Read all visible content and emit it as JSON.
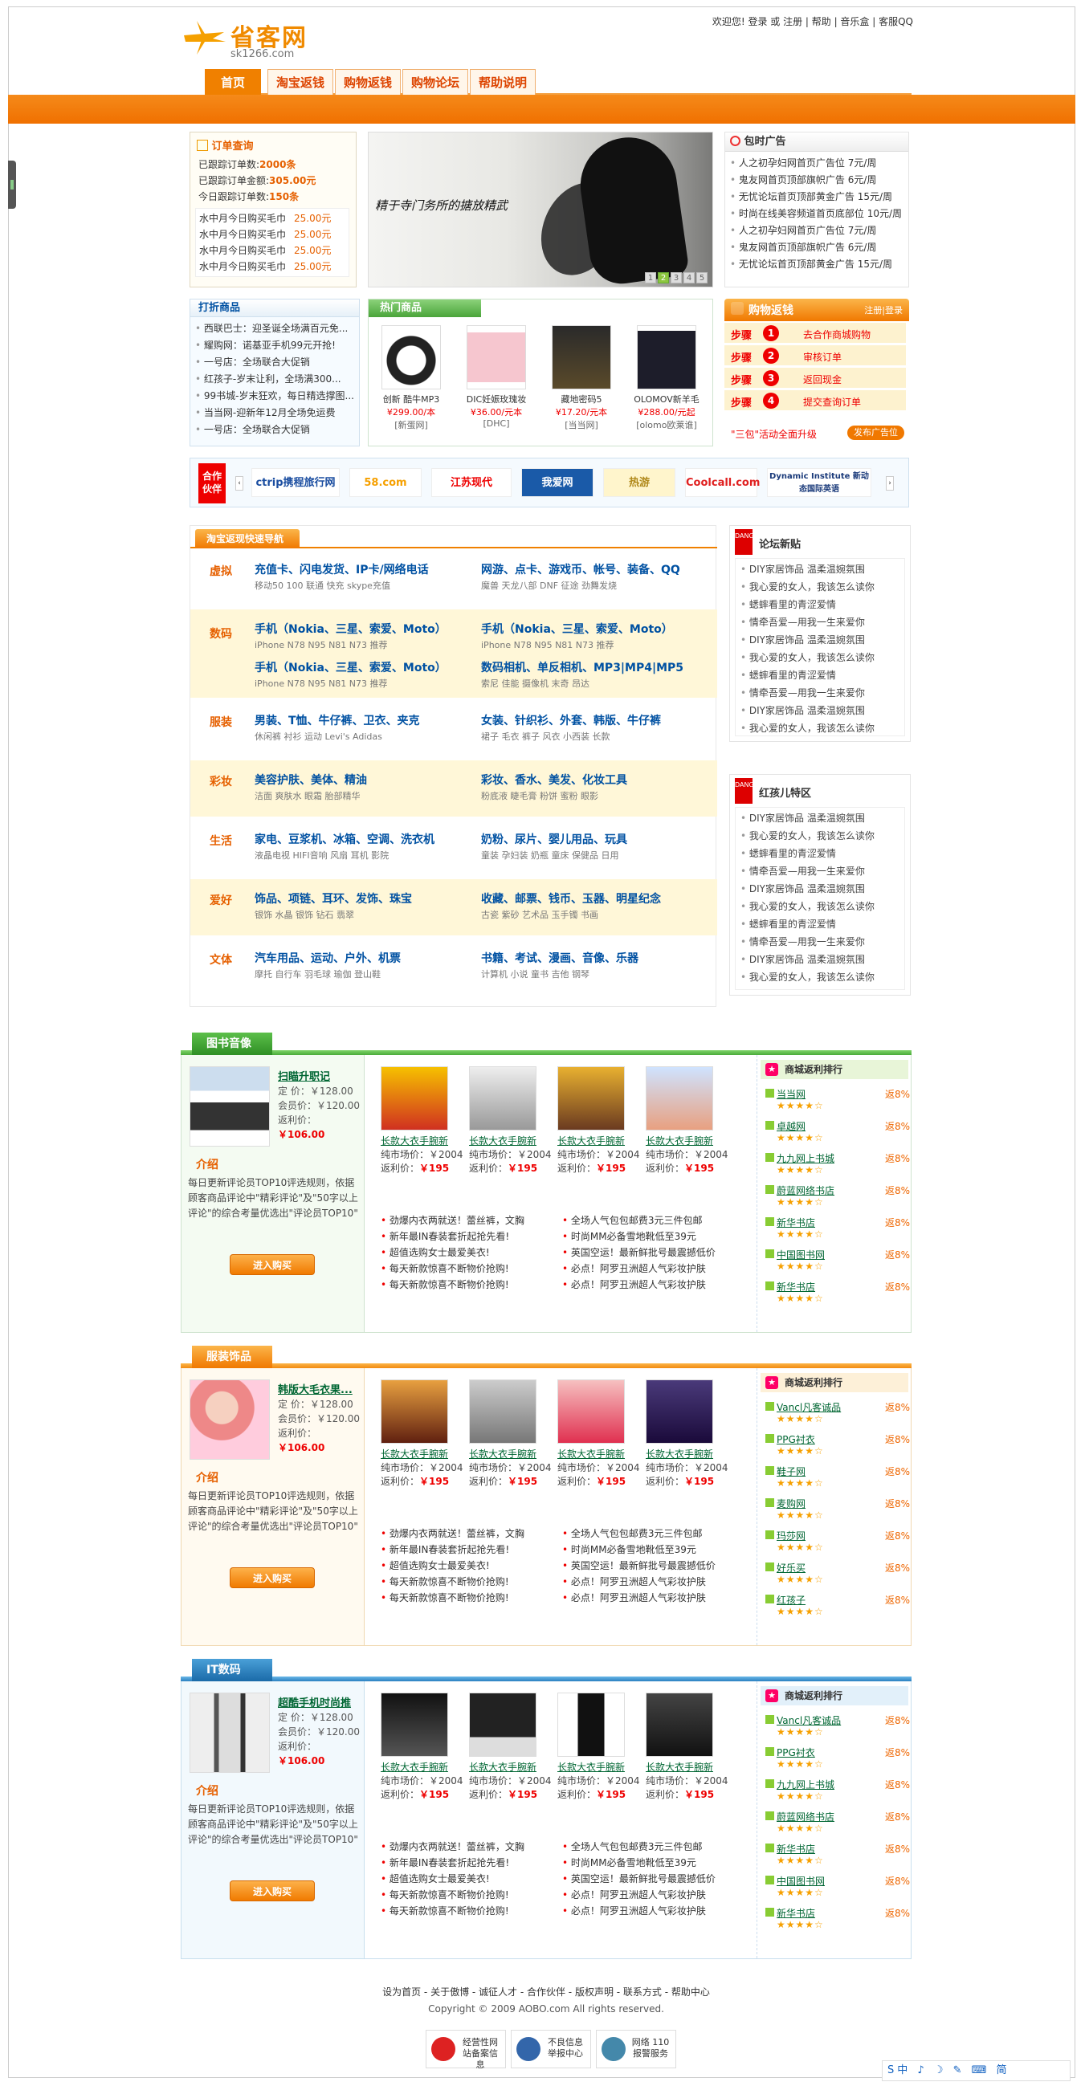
{
  "header": {
    "logo_text": "省客网",
    "logo_sub": "sk1266.com",
    "top_links": "欢迎您! 登录 或 注册 | 帮助 | 音乐盒 | 客服QQ"
  },
  "nav": [
    "首页",
    "淘宝返钱",
    "购物返钱",
    "购物论坛",
    "帮助说明"
  ],
  "orders": {
    "title": "订单查询",
    "stats": [
      {
        "label": "已跟踪订单数:",
        "value": "2000条"
      },
      {
        "label": "已跟踪订单金额:",
        "value": "305.00元"
      },
      {
        "label": "今日跟踪订单数:",
        "value": "150条"
      }
    ],
    "items": [
      {
        "name": "水中月今日购买毛巾",
        "price": "25.00元"
      },
      {
        "name": "水中月今日购买毛巾",
        "price": "25.00元"
      },
      {
        "name": "水中月今日购买毛巾",
        "price": "25.00元"
      },
      {
        "name": "水中月今日购买毛巾",
        "price": "25.00元"
      }
    ]
  },
  "banner": {
    "slogan": "精于寺门务所的搪放精武",
    "pages": [
      "1",
      "2",
      "3",
      "4",
      "5"
    ],
    "active_page": "2"
  },
  "ads": {
    "title": "包时广告",
    "items": [
      "人之初孕妇网首页广告位 7元/周",
      "鬼友网首页顶部旗帜广告 6元/周",
      "无忧论坛首页顶部黄金广告 15元/周",
      "时尚在线美容频道首页底部位 10元/周",
      "人之初孕妇网首页广告位 7元/周",
      "鬼友网首页顶部旗帜广告 6元/周",
      "无忧论坛首页顶部黄金广告 15元/周"
    ]
  },
  "deals": {
    "title": "打折商品",
    "items": [
      "西联巴士：迎圣诞全场满百元免...",
      "耀购网：诺基亚手机99元开抢!",
      "一号店：全场联合大促销",
      "红孩子-岁末让利，全场满300...",
      "99书城-岁末狂欢，每日精选撑图...",
      "当当网-迎新年12月全场免运费",
      "一号店：全场联合大促销"
    ]
  },
  "hot": {
    "title": "热门商品",
    "items": [
      {
        "name": "创新 酷牛MP3",
        "price": "¥299.00/本",
        "shop": "[新蛋网]"
      },
      {
        "name": "DIC妊娠玫瑰妆",
        "price": "¥36.00/元本",
        "shop": "[DHC]"
      },
      {
        "name": "藏地密码5",
        "price": "¥17.20/元本",
        "shop": "[当当网]"
      },
      {
        "name": "OLOMOV新羊毛",
        "price": "¥288.00/元起",
        "shop": "[olomo欧莱谁]"
      }
    ]
  },
  "shop_steps": {
    "title": "购物返钱",
    "login": "注册|登录",
    "steps": [
      {
        "label": "步骤",
        "num": "1",
        "text": "去合作商城购物"
      },
      {
        "label": "步骤",
        "num": "2",
        "text": "审核订单"
      },
      {
        "label": "步骤",
        "num": "3",
        "text": "返回现金"
      },
      {
        "label": "步骤",
        "num": "4",
        "text": "提交查询订单"
      }
    ],
    "footer_left": "\"三包\"活动全面升级",
    "footer_right": "发布广告位"
  },
  "partners": {
    "title": "合作伙伴",
    "items": [
      "ctrip携程旅行网",
      "58.com",
      "江苏现代",
      "我爱网",
      "热游",
      "Coolcall.com",
      "Dynamic Institute 新动态国际英语"
    ]
  },
  "guide": {
    "title": "淘宝返现快速导航",
    "rows": [
      {
        "cat": "虚拟",
        "a_main": "充值卡、闪电发货、IP卡/网络电话",
        "a_sub": "移动50  100  联通  快充  skype充值",
        "b_main": "网游、点卡、游戏币、帐号、装备、QQ",
        "b_sub": "魔兽  天龙八部  DNF  征途  劲舞发烧",
        "c_main": "",
        "c_sub": "",
        "d_main": "",
        "d_sub": ""
      },
      {
        "cat": "数码",
        "a_main": "手机（Nokia、三星、索爱、Moto）",
        "a_sub": "iPhone  N78  N95  N81  N73  推荐",
        "b_main": "手机（Nokia、三星、索爱、Moto）",
        "b_sub": "iPhone  N78  N95  N81  N73  推荐",
        "c_main": "手机（Nokia、三星、索爱、Moto）",
        "c_sub": "iPhone  N78  N95  N81  N73  推荐",
        "d_main": "数码相机、单反相机、MP3|MP4|MP5",
        "d_sub": "索尼  佳能  摄像机  末奇  昂达"
      },
      {
        "cat": "服装",
        "a_main": "男装、T恤、牛仔裤、卫衣、夹克",
        "a_sub": "休闲裤  衬衫  运动  Levi's  Adidas",
        "b_main": "女装、针织衫、外套、韩版、牛仔裤",
        "b_sub": "裙子  毛衣  裤子  风衣  小西装  长款",
        "c_main": "",
        "c_sub": "",
        "d_main": "",
        "d_sub": ""
      },
      {
        "cat": "彩妆",
        "a_main": "美容护肤、美体、精油",
        "a_sub": "洁面  爽肤水  眼霜  胎部精华",
        "b_main": "彩妆、香水、美发、化妆工具",
        "b_sub": "粉底液  睫毛膏  粉饼  蜜粉  眼影",
        "c_main": "",
        "c_sub": "",
        "d_main": "",
        "d_sub": ""
      },
      {
        "cat": "生活",
        "a_main": "家电、豆浆机、冰箱、空调、洗衣机",
        "a_sub": "液晶电视  HIFI音响  风扇  耳机  影院",
        "b_main": "奶粉、尿片、婴儿用品、玩具",
        "b_sub": "童装  孕妇装  奶瓶  童床  保健品  日用",
        "c_main": "",
        "c_sub": "",
        "d_main": "",
        "d_sub": ""
      },
      {
        "cat": "爱好",
        "a_main": "饰品、项链、耳环、发饰、珠宝",
        "a_sub": "银饰  水晶  银饰  钻石  翡翠",
        "b_main": "收藏、邮票、钱币、玉器、明星纪念",
        "b_sub": "古瓷  紫砂  艺术品  玉手镯  书画",
        "c_main": "",
        "c_sub": "",
        "d_main": "",
        "d_sub": ""
      },
      {
        "cat": "文体",
        "a_main": "汽车用品、运动、户外、机票",
        "a_sub": "摩托  自行车  羽毛球  瑜伽  登山鞋",
        "b_main": "书籍、考试、漫画、音像、乐器",
        "b_sub": "计算机  小说  童书  吉他  钢琴",
        "c_main": "",
        "c_sub": "",
        "d_main": "",
        "d_sub": ""
      }
    ]
  },
  "forum": {
    "title": "论坛新贴",
    "badge": "DANG",
    "items": [
      "DIY家居饰品 温柔温婉氛围",
      "我心爱的女人，我该怎么读你",
      "蟋蟀看里的青涩爱情",
      "情牵吾爱—用我一生来爱你",
      "DIY家居饰品 温柔温婉氛围",
      "我心爱的女人，我该怎么读你",
      "蟋蟀看里的青涩爱情",
      "情牵吾爱—用我一生来爱你",
      "DIY家居饰品 温柔温婉氛围",
      "我心爱的女人，我该怎么读你"
    ]
  },
  "kids": {
    "title": "红孩儿特区",
    "badge": "DANG",
    "items": [
      "DIY家居饰品 温柔温婉氛围",
      "我心爱的女人，我该怎么读你",
      "蟋蟀看里的青涩爱情",
      "情牵吾爱—用我一生来爱你",
      "DIY家居饰品 温柔温婉氛围",
      "我心爱的女人，我该怎么读你",
      "蟋蟀看里的青涩爱情",
      "情牵吾爱—用我一生来爱你",
      "DIY家居饰品 温柔温婉氛围",
      "我心爱的女人，我该怎么读你"
    ]
  },
  "sections": [
    {
      "title": "图书音像",
      "feature": {
        "name": "扫瞄升职记",
        "list": "定  价：￥128.00",
        "member": "会员价：￥120.00",
        "rebate": "返利价：",
        "rebate_val": "￥106.00"
      },
      "intro_title": "介绍",
      "intro": "每日更新评论员TOP10评选规则，依据顾客商品评论中\"精彩评论\"及\"50字以上评论\"的综合考量优选出\"评论员TOP10\"",
      "buy": "进入购买",
      "products": [
        {
          "name": "长款大衣手腕新",
          "market": "纯市场价：￥2004",
          "rebate": "返利价：",
          "rebate_val": "￥195"
        },
        {
          "name": "长款大衣手腕新",
          "market": "纯市场价：￥2004",
          "rebate": "返利价：",
          "rebate_val": "￥195"
        },
        {
          "name": "长款大衣手腕新",
          "market": "纯市场价：￥2004",
          "rebate": "返利价：",
          "rebate_val": "￥195"
        },
        {
          "name": "长款大衣手腕新",
          "market": "纯市场价：￥2004",
          "rebate": "返利价：",
          "rebate_val": "￥195"
        }
      ],
      "promo_left": [
        "劲爆内衣两就送！蕾丝裤，文胸",
        "新年最IN春装套折起抢先看!",
        "超值选购女士最爱美衣!",
        "每天新款惊喜不断物价抢购!",
        "每天新款惊喜不断物价抢购!"
      ],
      "promo_right": [
        "全场人气包包邮费3元三件包邮",
        "时尚MM必备雪地靴低至39元",
        "英国空运！最新鲜批号最震撼低价",
        "必点！阿罗丑洲超人气彩妆护肤",
        "必点！阿罗丑洲超人气彩妆护肤"
      ],
      "rank_title": "商城返利排行",
      "rank": [
        {
          "name": "当当网",
          "pct": "返8%"
        },
        {
          "name": "卓越网",
          "pct": "返8%"
        },
        {
          "name": "九九网上书城",
          "pct": "返8%"
        },
        {
          "name": "蔚蓝网络书店",
          "pct": "返8%"
        },
        {
          "name": "新华书店",
          "pct": "返8%"
        },
        {
          "name": "中国图书网",
          "pct": "返8%"
        },
        {
          "name": "新华书店",
          "pct": "返8%"
        }
      ]
    },
    {
      "title": "服装饰品",
      "feature": {
        "name": "韩版大毛衣果...",
        "list": "定  价：￥128.00",
        "member": "会员价：￥120.00",
        "rebate": "返利价：",
        "rebate_val": "￥106.00"
      },
      "intro_title": "介绍",
      "intro": "每日更新评论员TOP10评选规则，依据顾客商品评论中\"精彩评论\"及\"50字以上评论\"的综合考量优选出\"评论员TOP10\"",
      "buy": "进入购买",
      "products": [
        {
          "name": "长款大衣手腕新",
          "market": "纯市场价：￥2004",
          "rebate": "返利价：",
          "rebate_val": "￥195"
        },
        {
          "name": "长款大衣手腕新",
          "market": "纯市场价：￥2004",
          "rebate": "返利价：",
          "rebate_val": "￥195"
        },
        {
          "name": "长款大衣手腕新",
          "market": "纯市场价：￥2004",
          "rebate": "返利价：",
          "rebate_val": "￥195"
        },
        {
          "name": "长款大衣手腕新",
          "market": "纯市场价：￥2004",
          "rebate": "返利价：",
          "rebate_val": "￥195"
        }
      ],
      "promo_left": [
        "劲爆内衣两就送！蕾丝裤，文胸",
        "新年最IN春装套折起抢先看!",
        "超值选购女士最爱美衣!",
        "每天新款惊喜不断物价抢购!",
        "每天新款惊喜不断物价抢购!"
      ],
      "promo_right": [
        "全场人气包包邮费3元三件包邮",
        "时尚MM必备雪地靴低至39元",
        "英国空运！最新鲜批号最震撼低价",
        "必点！阿罗丑洲超人气彩妆护肤",
        "必点！阿罗丑洲超人气彩妆护肤"
      ],
      "rank_title": "商城返利排行",
      "rank": [
        {
          "name": "Vancl凡客诚品",
          "pct": "返8%"
        },
        {
          "name": "PPG衬衣",
          "pct": "返8%"
        },
        {
          "name": "鞋子网",
          "pct": "返8%"
        },
        {
          "name": "麦购网",
          "pct": "返8%"
        },
        {
          "name": "玛莎网",
          "pct": "返8%"
        },
        {
          "name": "好乐买",
          "pct": "返8%"
        },
        {
          "name": "红孩子",
          "pct": "返8%"
        }
      ]
    },
    {
      "title": "IT数码",
      "feature": {
        "name": "超酷手机时尚推",
        "list": "定  价：￥128.00",
        "member": "会员价：￥120.00",
        "rebate": "返利价：",
        "rebate_val": "￥106.00"
      },
      "intro_title": "介绍",
      "intro": "每日更新评论员TOP10评选规则，依据顾客商品评论中\"精彩评论\"及\"50字以上评论\"的综合考量优选出\"评论员TOP10\"",
      "buy": "进入购买",
      "products": [
        {
          "name": "长款大衣手腕新",
          "market": "纯市场价：￥2004",
          "rebate": "返利价：",
          "rebate_val": "￥195"
        },
        {
          "name": "长款大衣手腕新",
          "market": "纯市场价：￥2004",
          "rebate": "返利价：",
          "rebate_val": "￥195"
        },
        {
          "name": "长款大衣手腕新",
          "market": "纯市场价：￥2004",
          "rebate": "返利价：",
          "rebate_val": "￥195"
        },
        {
          "name": "长款大衣手腕新",
          "market": "纯市场价：￥2004",
          "rebate": "返利价：",
          "rebate_val": "￥195"
        }
      ],
      "promo_left": [
        "劲爆内衣两就送！蕾丝裤，文胸",
        "新年最IN春装套折起抢先看!",
        "超值选购女士最爱美衣!",
        "每天新款惊喜不断物价抢购!",
        "每天新款惊喜不断物价抢购!"
      ],
      "promo_right": [
        "全场人气包包邮费3元三件包邮",
        "时尚MM必备雪地靴低至39元",
        "英国空运！最新鲜批号最震撼低价",
        "必点！阿罗丑洲超人气彩妆护肤",
        "必点！阿罗丑洲超人气彩妆护肤"
      ],
      "rank_title": "商城返利排行",
      "rank": [
        {
          "name": "Vancl凡客诚品",
          "pct": "返8%"
        },
        {
          "name": "PPG衬衣",
          "pct": "返8%"
        },
        {
          "name": "九九网上书城",
          "pct": "返8%"
        },
        {
          "name": "蔚蓝网络书店",
          "pct": "返8%"
        },
        {
          "name": "新华书店",
          "pct": "返8%"
        },
        {
          "name": "中国图书网",
          "pct": "返8%"
        },
        {
          "name": "新华书店",
          "pct": "返8%"
        }
      ]
    }
  ],
  "footer": {
    "links": "设为首页 - 关于傲博 - 诚征人才 - 合作伙伴 - 版权声明 - 联系方式 - 帮助中心",
    "copyright": "Copyright © 2009 AOBO.com All rights reserved.",
    "badges": [
      "经营性网站备案信息",
      "不良信息举报中心",
      "网络 110 报警服务"
    ]
  },
  "ime": "S中 ♪ ☽ ✎ ⌨ 简"
}
